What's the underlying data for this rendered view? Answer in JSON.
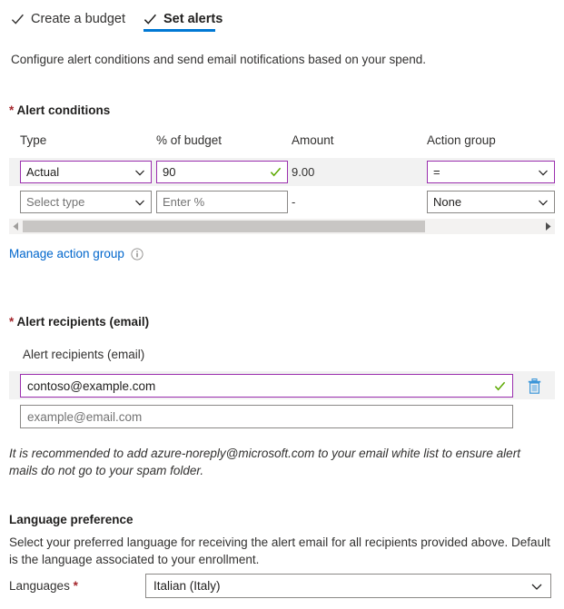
{
  "tabs": [
    {
      "label": "Create a budget",
      "icon": "check-icon",
      "active": false
    },
    {
      "label": "Set alerts",
      "icon": "check-icon",
      "active": true
    }
  ],
  "intro": "Configure alert conditions and send email notifications based on your spend.",
  "alert_conditions": {
    "section_label": "Alert conditions",
    "required_marker": "*",
    "columns": [
      "Type",
      "% of budget",
      "Amount",
      "Action group"
    ],
    "rows": [
      {
        "type": "Actual",
        "type_is_placeholder": false,
        "percent": "90",
        "percent_is_placeholder": false,
        "percent_valid": true,
        "amount": "9.00",
        "action_group": "=",
        "action_is_placeholder": false,
        "selected": true
      },
      {
        "type": "Select type",
        "type_is_placeholder": true,
        "percent": "Enter %",
        "percent_is_placeholder": true,
        "percent_valid": false,
        "amount": "-",
        "action_group": "None",
        "action_is_placeholder": false,
        "selected": false
      }
    ],
    "scrollbar": {
      "left_arrow": "caret-left-icon",
      "right_arrow": "caret-right-icon",
      "thumb_percent": 75
    },
    "manage_link": "Manage action group",
    "manage_info_icon": "info-icon"
  },
  "alert_recipients": {
    "section_label": "Alert recipients (email)",
    "required_marker": "*",
    "field_label": "Alert recipients (email)",
    "entries": [
      {
        "value": "contoso@example.com",
        "is_placeholder": false,
        "valid": true,
        "has_delete": true,
        "delete_icon": "trash-icon"
      },
      {
        "value": "example@email.com",
        "is_placeholder": true,
        "valid": false,
        "has_delete": false
      }
    ],
    "note": "It is recommended to add azure-noreply@microsoft.com to your email white list to ensure alert mails do not go to your spam folder."
  },
  "language_preference": {
    "heading": "Language preference",
    "description": "Select your preferred language for receiving the alert email for all recipients provided above. Default is the language associated to your enrollment.",
    "field_label": "Languages",
    "required_marker": "*",
    "selected_language": "Italian (Italy)",
    "chevron_icon": "chevron-down-icon"
  },
  "colors": {
    "accent_blue": "#0078d4",
    "link_blue": "#0066cc",
    "required_red": "#a4262c",
    "focus_purple": "#9b2fae",
    "valid_green": "#5ca900",
    "row_highlight": "#f2f2f2",
    "border_gray": "#8a8886"
  }
}
